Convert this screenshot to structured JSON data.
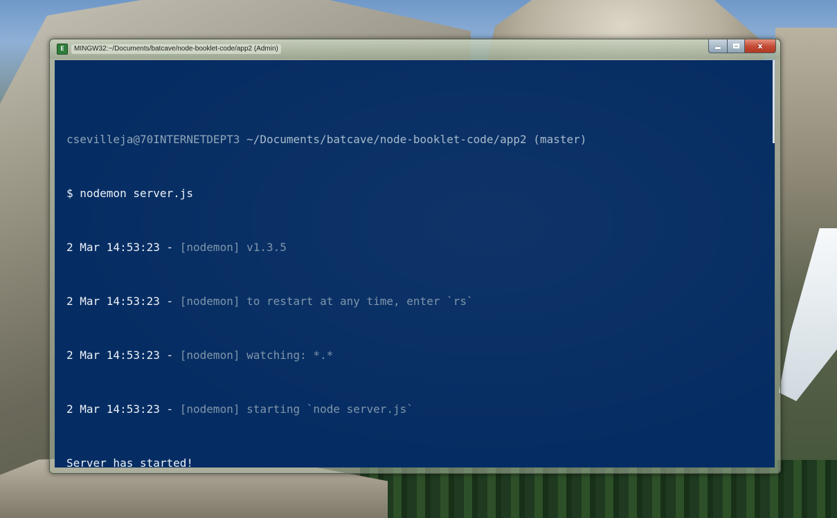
{
  "window": {
    "title": "MINGW32:~/Documents/batcave/node-booklet-code/app2 (Admin)",
    "icon": "terminal-icon"
  },
  "controls": {
    "minimize_icon": "minimize-icon",
    "maximize_icon": "maximize-icon",
    "close_label": "x"
  },
  "terminal": {
    "prompt": {
      "user_host": "csevilleja@70INTERNETDEPT3",
      "path": "~/Documents/batcave/node-booklet-code/app2 (master)"
    },
    "command": "$ nodemon server.js",
    "log": [
      {
        "timestamp": "2 Mar 14:53:23 - ",
        "tag": "[nodemon]",
        "message": " v1.3.5"
      },
      {
        "timestamp": "2 Mar 14:53:23 - ",
        "tag": "[nodemon]",
        "message": " to restart at any time, enter `rs`"
      },
      {
        "timestamp": "2 Mar 14:53:23 - ",
        "tag": "[nodemon]",
        "message": " watching: *.*"
      },
      {
        "timestamp": "2 Mar 14:53:23 - ",
        "tag": "[nodemon]",
        "message": " starting `node server.js`"
      }
    ],
    "output": "Server has started!"
  },
  "colors": {
    "console_background": "#062d63",
    "bright_text": "#eef2f8",
    "dim_text": "#7f96aa"
  }
}
